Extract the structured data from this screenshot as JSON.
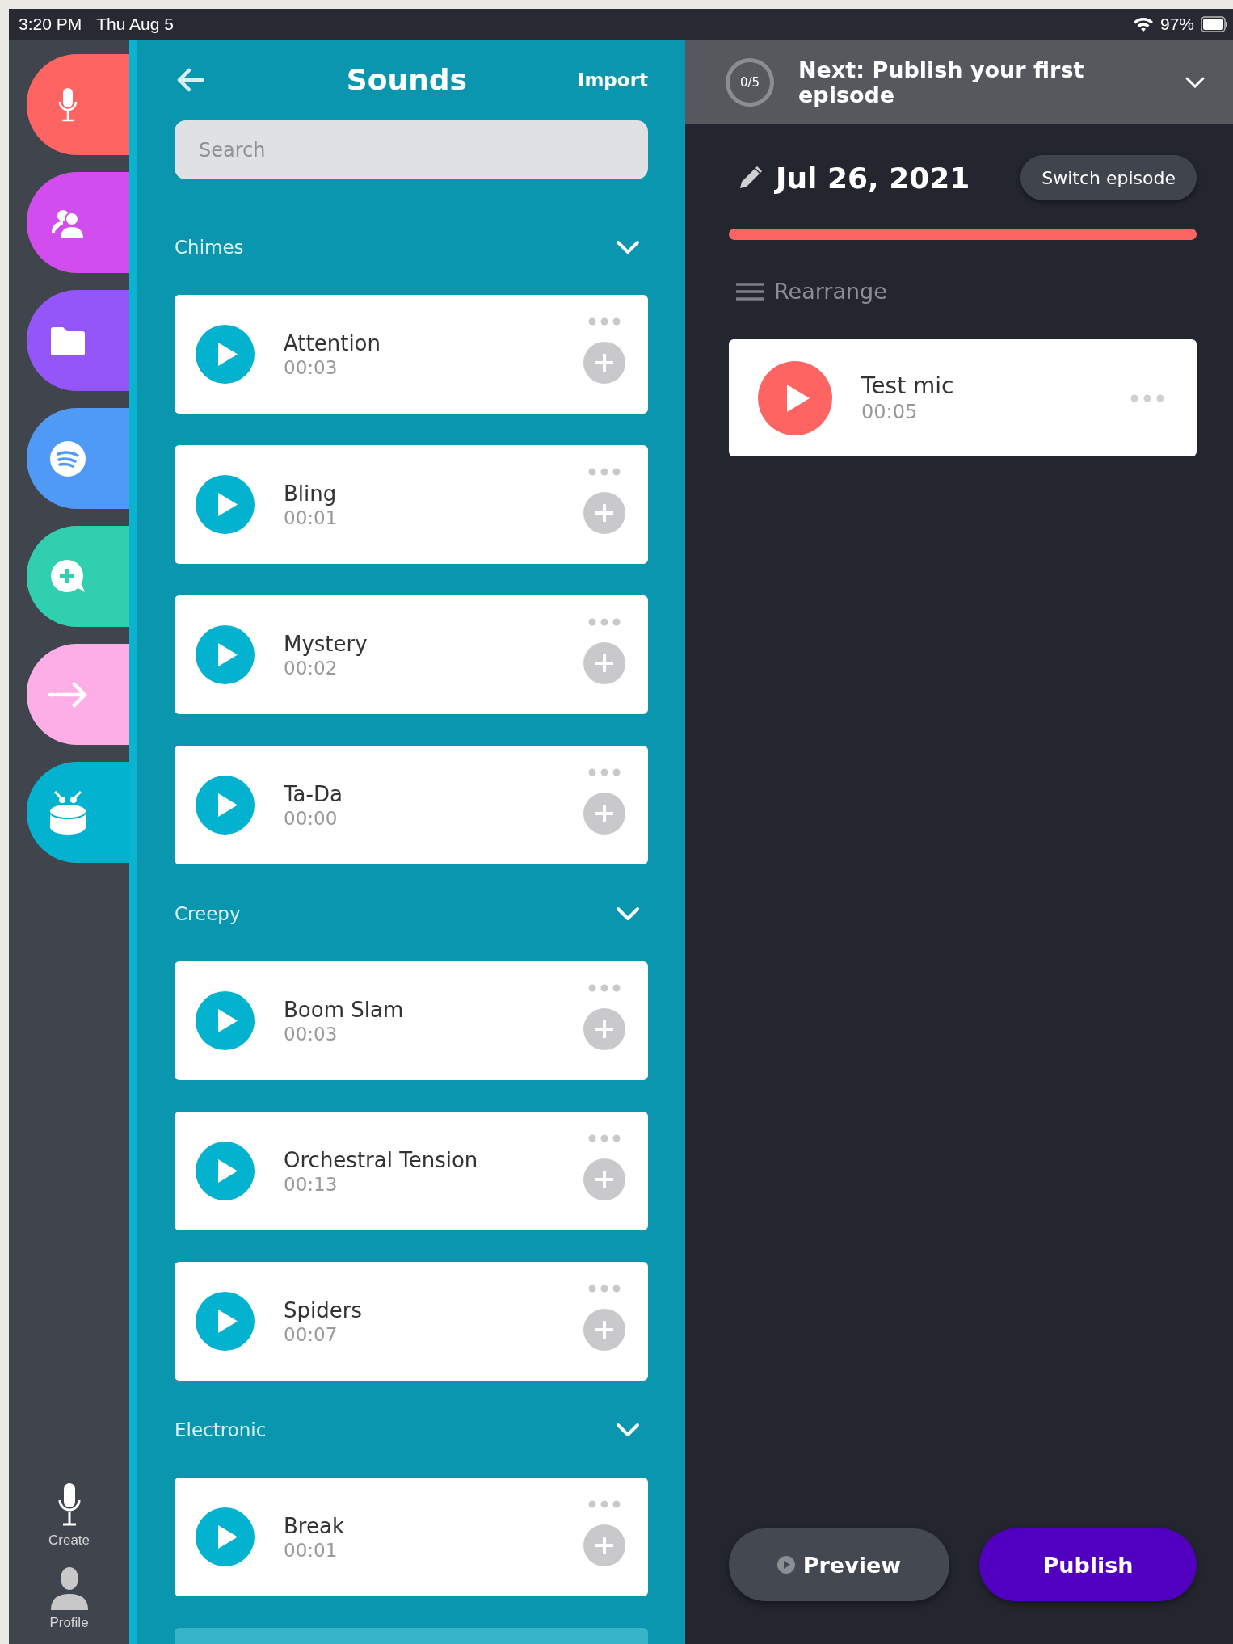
{
  "status_bar": {
    "time": "3:20 PM",
    "date": "Thu Aug 5",
    "battery": "97%"
  },
  "nav_rail": {
    "items": [
      {
        "kind": "mic",
        "color": "#fd6462"
      },
      {
        "kind": "people",
        "color": "#d24ded"
      },
      {
        "kind": "folder",
        "color": "#9455f9"
      },
      {
        "kind": "stream",
        "color": "#4f9af5"
      },
      {
        "kind": "chat-add",
        "color": "#2fcfb0"
      },
      {
        "kind": "forward",
        "color": "#fdaee6"
      },
      {
        "kind": "drum",
        "color": "#03b2cf"
      }
    ],
    "bottom_items": [
      {
        "kind": "mic",
        "label": "Create"
      },
      {
        "kind": "person",
        "label": "Profile"
      }
    ]
  },
  "sounds_panel": {
    "title": "Sounds",
    "action": "Import",
    "search": {
      "placeholder": "Search"
    },
    "sections": [
      {
        "name": "Chimes",
        "expanded": true,
        "sounds": [
          {
            "name": "Attention",
            "duration": "00:03"
          },
          {
            "name": "Bling",
            "duration": "00:01"
          },
          {
            "name": "Mystery",
            "duration": "00:02"
          },
          {
            "name": "Ta-Da",
            "duration": "00:00"
          }
        ]
      },
      {
        "name": "Creepy",
        "expanded": true,
        "sounds": [
          {
            "name": "Boom Slam",
            "duration": "00:03"
          },
          {
            "name": "Orchestral Tension",
            "duration": "00:13"
          },
          {
            "name": "Spiders",
            "duration": "00:07"
          }
        ]
      },
      {
        "name": "Electronic",
        "expanded": true,
        "sounds": [
          {
            "name": "Break",
            "duration": "00:01"
          }
        ]
      }
    ]
  },
  "episode_panel": {
    "checklist": {
      "progress": "0/5",
      "title": "Next: Publish your first episode"
    },
    "date": "Jul 26, 2021",
    "switch_button": "Switch episode",
    "rearrange": "Rearrange",
    "segments": [
      {
        "name": "Test mic",
        "duration": "00:05"
      }
    ],
    "preview_button": "Preview",
    "publish_button": "Publish"
  }
}
